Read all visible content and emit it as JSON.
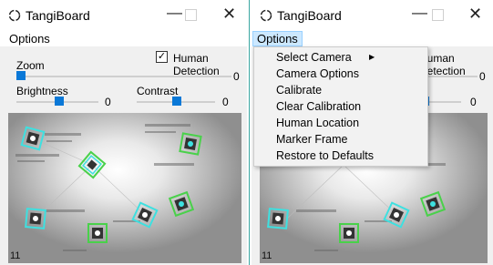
{
  "app": {
    "title": "TangiBoard"
  },
  "menu": {
    "options_label": "Options"
  },
  "controls": {
    "zoom_label": "Zoom",
    "zoom_value": "0",
    "human_detection_label": "Human Detection",
    "human_detection_checked": true,
    "brightness_label": "Brightness",
    "brightness_value": "0",
    "contrast_label": "Contrast",
    "contrast_value": "0"
  },
  "camera": {
    "frame_count": "11"
  },
  "dropdown": {
    "items": [
      "Select Camera",
      "Camera Options",
      "Calibrate",
      "Clear Calibration",
      "Human Location",
      "Marker Frame",
      "Restore to Defaults"
    ]
  },
  "colors": {
    "accent": "#0a78d7",
    "menu_highlight": "#cce8ff",
    "marker_cyan": "#3ee0e0",
    "marker_green": "#49d14a"
  }
}
